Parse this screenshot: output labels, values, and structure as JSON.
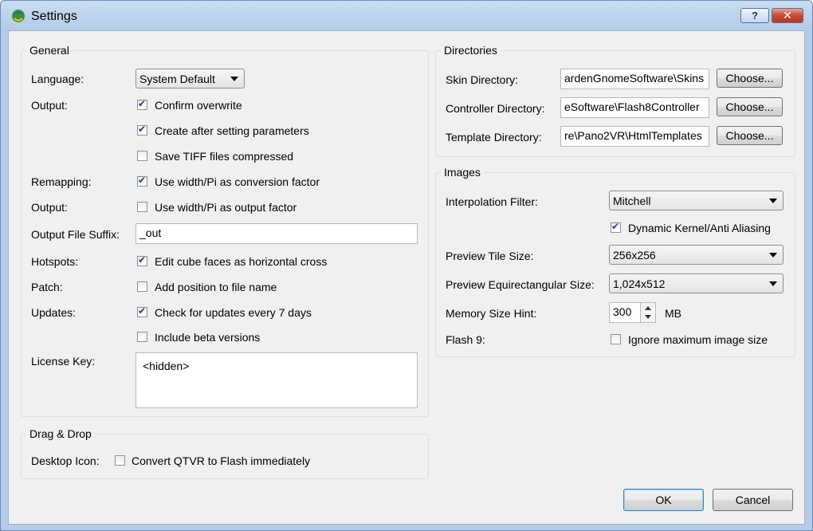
{
  "window": {
    "title": "Settings",
    "help_label": "?",
    "close_label": "✕"
  },
  "general": {
    "title": "General",
    "language_label": "Language:",
    "language_value": "System Default",
    "output_label": "Output:",
    "confirm_overwrite": {
      "label": "Confirm overwrite",
      "checked": true
    },
    "create_after": {
      "label": "Create after setting parameters",
      "checked": true
    },
    "save_tiff": {
      "label": "Save TIFF files compressed",
      "checked": false
    },
    "remapping_label": "Remapping:",
    "use_width_pi_conv": {
      "label": "Use width/Pi as conversion factor",
      "checked": true
    },
    "output_label2": "Output:",
    "use_width_pi_out": {
      "label": "Use width/Pi as output factor",
      "checked": false
    },
    "suffix_label": "Output File Suffix:",
    "suffix_value": "_out",
    "hotspots_label": "Hotspots:",
    "edit_cube": {
      "label": "Edit cube faces as horizontal cross",
      "checked": true
    },
    "patch_label": "Patch:",
    "add_position": {
      "label": "Add position to file name",
      "checked": false
    },
    "updates_label": "Updates:",
    "check_updates": {
      "label": "Check for updates every 7 days",
      "checked": true
    },
    "include_beta": {
      "label": "Include beta versions",
      "checked": false
    },
    "license_label": "License Key:",
    "license_value": "<hidden>"
  },
  "dragdrop": {
    "title": "Drag & Drop",
    "desktop_label": "Desktop Icon:",
    "convert": {
      "label": "Convert QTVR to Flash immediately",
      "checked": false
    }
  },
  "directories": {
    "title": "Directories",
    "skin_label": "Skin Directory:",
    "skin_value": "ardenGnomeSoftware\\Skins",
    "controller_label": "Controller Directory:",
    "controller_value": "eSoftware\\Flash8Controller",
    "template_label": "Template Directory:",
    "template_value": "re\\Pano2VR\\HtmlTemplates",
    "choose_label": "Choose..."
  },
  "images": {
    "title": "Images",
    "interp_label": "Interpolation Filter:",
    "interp_value": "Mitchell",
    "dynamic_kernel": {
      "label": "Dynamic Kernel/Anti Aliasing",
      "checked": true
    },
    "tile_label": "Preview Tile Size:",
    "tile_value": "256x256",
    "equi_label": "Preview Equirectangular Size:",
    "equi_value": "1,024x512",
    "memory_label": "Memory Size Hint:",
    "memory_value": "300",
    "memory_unit": "MB",
    "flash_label": "Flash 9:",
    "ignore_max": {
      "label": "Ignore maximum image size",
      "checked": false
    }
  },
  "buttons": {
    "ok": "OK",
    "cancel": "Cancel"
  }
}
